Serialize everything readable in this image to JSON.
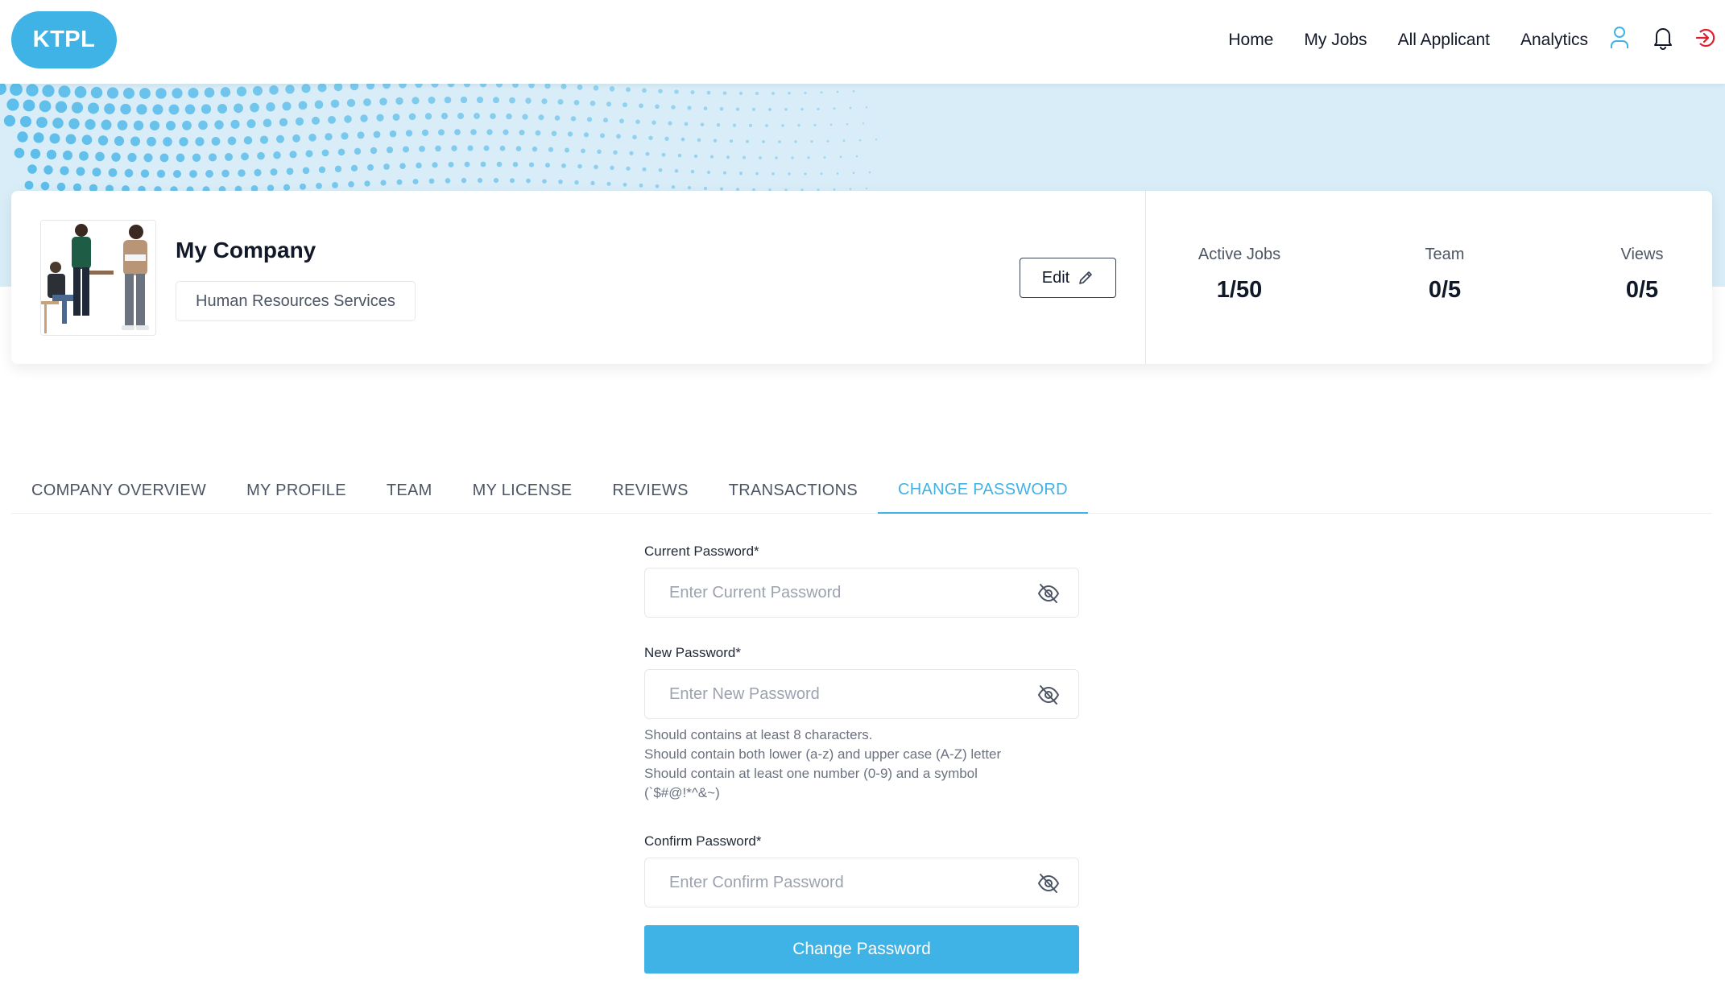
{
  "brand": {
    "logo_text": "KTPL",
    "accent": "#3fb2e6"
  },
  "nav": {
    "links": [
      "Home",
      "My Jobs",
      "All Applicant",
      "Analytics"
    ],
    "icons": [
      "user-icon",
      "bell-icon",
      "logout-icon"
    ]
  },
  "company": {
    "name": "My Company",
    "industry": "Human Resources Services",
    "edit_label": "Edit"
  },
  "stats": [
    {
      "label": "Active Jobs",
      "value": "1/50"
    },
    {
      "label": "Team",
      "value": "0/5"
    },
    {
      "label": "Views",
      "value": "0/5"
    }
  ],
  "tabs": [
    "COMPANY OVERVIEW",
    "MY PROFILE",
    "TEAM",
    "MY LICENSE",
    "REVIEWS",
    "TRANSACTIONS",
    "CHANGE PASSWORD"
  ],
  "active_tab": "CHANGE PASSWORD",
  "form": {
    "current": {
      "label": "Current Password*",
      "placeholder": "Enter Current Password",
      "value": ""
    },
    "new": {
      "label": "New Password*",
      "placeholder": "Enter New Password",
      "value": ""
    },
    "hints": [
      "Should contains at least 8 characters.",
      "Should contain both lower (a-z) and upper case (A-Z) letter",
      "Should contain at least one number (0-9) and a symbol (`$#@!*^&~)"
    ],
    "confirm": {
      "label": "Confirm Password*",
      "placeholder": "Enter Confirm Password",
      "value": ""
    },
    "submit_label": "Change Password"
  }
}
